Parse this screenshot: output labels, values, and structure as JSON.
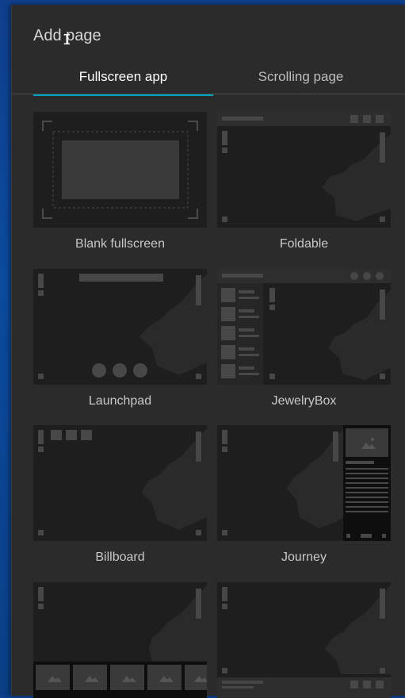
{
  "dialog": {
    "title": "Add page",
    "tabs": [
      {
        "label": "Fullscreen app",
        "active": true
      },
      {
        "label": "Scrolling page",
        "active": false
      }
    ]
  },
  "templates": [
    {
      "name": "Blank fullscreen",
      "preview": "blank-fullscreen-preview"
    },
    {
      "name": "Foldable",
      "preview": "foldable-preview"
    },
    {
      "name": "Launchpad",
      "preview": "launchpad-preview"
    },
    {
      "name": "JewelryBox",
      "preview": "jewelrybox-preview"
    },
    {
      "name": "Billboard",
      "preview": "billboard-preview"
    },
    {
      "name": "Journey",
      "preview": "journey-preview"
    },
    {
      "name": "",
      "preview": "gallery-strip-preview"
    },
    {
      "name": "",
      "preview": "footer-bar-preview"
    }
  ],
  "colors": {
    "panel": "#2b2b2b",
    "thumb_bg": "#1e1e1e",
    "thumb_shape": "#3a3a3a",
    "accent": "#00a3bf",
    "desktop": "#0b4a9e"
  }
}
